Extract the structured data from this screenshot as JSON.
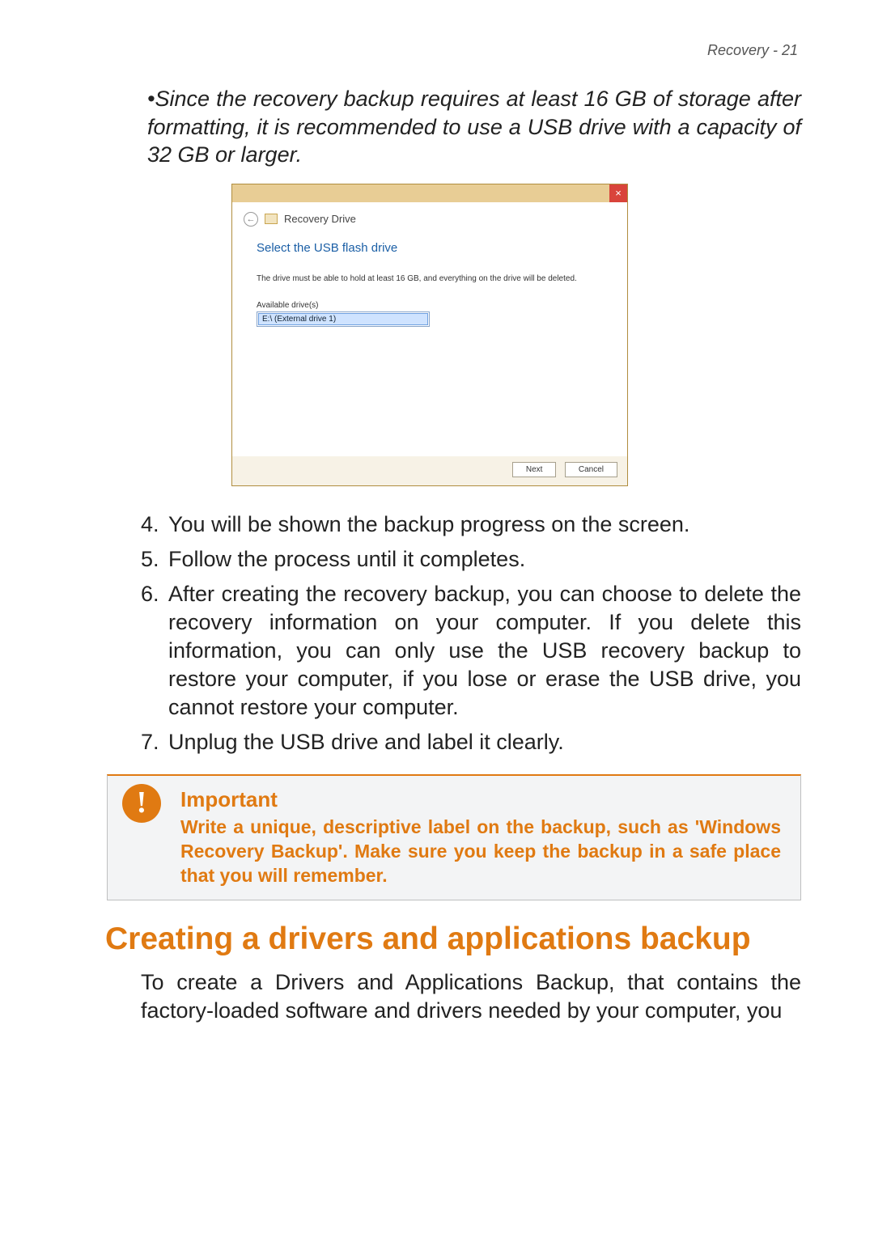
{
  "header": {
    "text": "Recovery - 21"
  },
  "bullet": {
    "text": "Since the recovery backup requires at least 16 GB of storage after formatting, it is recommended to use a USB drive with a capacity of 32 GB or larger."
  },
  "dialog": {
    "close": "×",
    "back_arrow": "←",
    "title": "Recovery Drive",
    "heading": "Select the USB flash drive",
    "body": "The drive must be able to hold at least 16 GB, and everything on the drive will be deleted.",
    "available_label": "Available drive(s)",
    "drive_item": "E:\\ (External drive 1)",
    "next": "Next",
    "cancel": "Cancel"
  },
  "steps": {
    "s4": "You will be shown the backup progress on the screen.",
    "s5": "Follow the process until it completes.",
    "s6": "After creating the recovery backup, you can choose to delete the recovery information on your computer. If you delete this information, you can only use the USB recovery backup to restore your computer, if you lose or erase the USB drive, you cannot restore your computer.",
    "s7": "Unplug the USB drive and label it clearly."
  },
  "callout": {
    "icon": "!",
    "title": "Important",
    "body": "Write a unique, descriptive label on the backup, such as 'Windows Recovery Backup'. Make sure you keep the backup in a safe place that you will remember."
  },
  "section": {
    "heading": "Creating a drivers and applications backup",
    "para": "To create a Drivers and Applications Backup, that contains the factory-loaded software and drivers needed by your computer, you"
  }
}
